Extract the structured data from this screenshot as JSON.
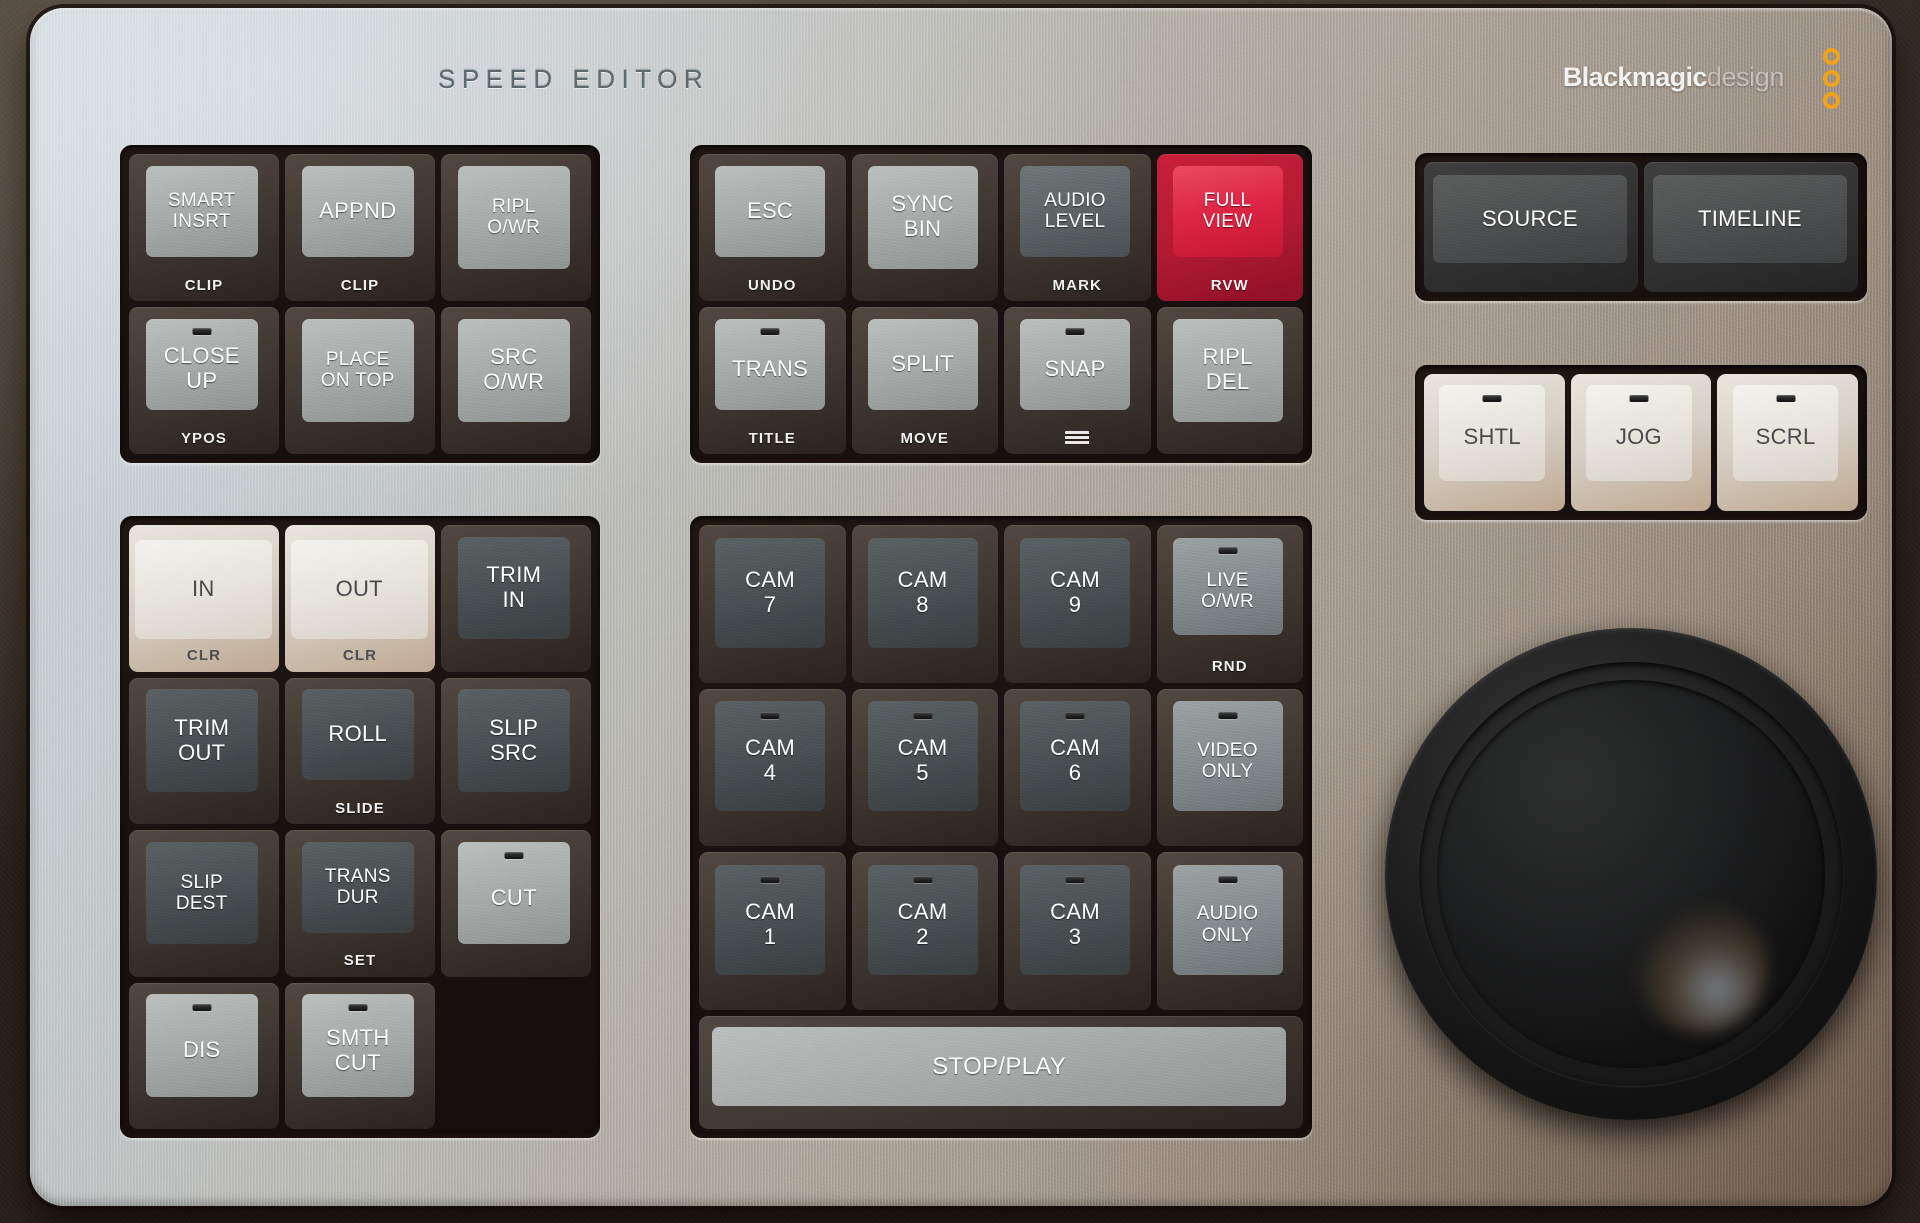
{
  "device": {
    "title": "SPEED EDITOR",
    "brand_primary": "Blackmagic",
    "brand_secondary": "design",
    "body_color": "#b4b2ab",
    "accent_red": "#dd2442",
    "brand_dot_color": "#f0a21c"
  },
  "groups": {
    "edit_group": {
      "name": "edit-functions",
      "keys": [
        {
          "label": "SMART\nINSRT",
          "sub": "CLIP",
          "cap": "gray-l",
          "housing": "lighthousing",
          "led": false
        },
        {
          "label": "APPND",
          "sub": "CLIP",
          "cap": "gray-l",
          "housing": "lighthousing",
          "led": false
        },
        {
          "label": "RIPL\nO/WR",
          "sub": "",
          "cap": "gray-l",
          "housing": "lighthousing",
          "led": false
        },
        {
          "label": "CLOSE\nUP",
          "sub": "YPOS",
          "cap": "gray-l",
          "housing": "lighthousing",
          "led": true
        },
        {
          "label": "PLACE\nON TOP",
          "sub": "",
          "cap": "gray-l",
          "housing": "lighthousing",
          "led": false
        },
        {
          "label": "SRC\nO/WR",
          "sub": "",
          "cap": "gray-l",
          "housing": "lighthousing",
          "led": false
        }
      ]
    },
    "transport_group": {
      "name": "timeline-tools",
      "keys": [
        {
          "label": "ESC",
          "sub": "UNDO",
          "cap": "gray-l",
          "housing": "lighthousing",
          "led": false
        },
        {
          "label": "SYNC\nBIN",
          "sub": "",
          "cap": "gray-l",
          "housing": "lighthousing",
          "led": false
        },
        {
          "label": "AUDIO\nLEVEL",
          "sub": "MARK",
          "cap": "gray-d",
          "housing": "lighthousing",
          "led": false
        },
        {
          "label": "FULL\nVIEW",
          "sub": "RVW",
          "cap": "red",
          "housing": "redhousing",
          "led": false
        },
        {
          "label": "TRANS",
          "sub": "TITLE",
          "cap": "gray-l",
          "housing": "lighthousing",
          "led": true
        },
        {
          "label": "SPLIT",
          "sub": "MOVE",
          "cap": "gray-l",
          "housing": "lighthousing",
          "led": false
        },
        {
          "label": "SNAP",
          "sub": "",
          "cap": "gray-l",
          "housing": "lighthousing",
          "led": true,
          "icon": "hamburger-icon"
        },
        {
          "label": "RIPL\nDEL",
          "sub": "",
          "cap": "gray-l",
          "housing": "lighthousing",
          "led": false
        }
      ]
    },
    "view_group": {
      "name": "source-timeline",
      "keys": [
        {
          "label": "SOURCE",
          "sub": "",
          "cap": "darkbtn",
          "housing": "darkhousing",
          "led": false
        },
        {
          "label": "TIMELINE",
          "sub": "",
          "cap": "darkbtn",
          "housing": "darkhousing",
          "led": false
        }
      ]
    },
    "wheel_mode_group": {
      "name": "wheel-modes",
      "keys": [
        {
          "label": "SHTL",
          "sub": "",
          "cap": "white",
          "housing": "whitehousing",
          "led": true
        },
        {
          "label": "JOG",
          "sub": "",
          "cap": "white",
          "housing": "whitehousing",
          "led": true
        },
        {
          "label": "SCRL",
          "sub": "",
          "cap": "white",
          "housing": "whitehousing",
          "led": true
        }
      ]
    },
    "trim_group": {
      "name": "trim-tools",
      "keys": [
        {
          "label": "IN",
          "sub": "CLR",
          "cap": "white",
          "housing": "whitehousing",
          "led": false,
          "sub_dark": true
        },
        {
          "label": "OUT",
          "sub": "CLR",
          "cap": "white",
          "housing": "whitehousing",
          "led": false,
          "sub_dark": true
        },
        {
          "label": "TRIM\nIN",
          "sub": "",
          "cap": "gray-dd",
          "housing": "lighthousing",
          "led": false
        },
        {
          "label": "TRIM\nOUT",
          "sub": "",
          "cap": "gray-dd",
          "housing": "lighthousing",
          "led": false
        },
        {
          "label": "ROLL",
          "sub": "SLIDE",
          "cap": "gray-dd",
          "housing": "lighthousing",
          "led": false
        },
        {
          "label": "SLIP\nSRC",
          "sub": "",
          "cap": "gray-dd",
          "housing": "lighthousing",
          "led": false
        },
        {
          "label": "SLIP\nDEST",
          "sub": "",
          "cap": "gray-dd",
          "housing": "lighthousing",
          "led": false
        },
        {
          "label": "TRANS\nDUR",
          "sub": "SET",
          "cap": "gray-dd",
          "housing": "lighthousing",
          "led": false
        },
        {
          "label": "CUT",
          "sub": "",
          "cap": "gray-l",
          "housing": "lighthousing",
          "led": true
        },
        {
          "label": "DIS",
          "sub": "",
          "cap": "gray-l",
          "housing": "lighthousing",
          "led": true
        },
        {
          "label": "SMTH\nCUT",
          "sub": "",
          "cap": "gray-l",
          "housing": "lighthousing",
          "led": true
        }
      ]
    },
    "camera_group": {
      "name": "camera-selection",
      "keys": [
        {
          "label": "CAM\n7",
          "sub": "",
          "cap": "gray-dd",
          "housing": "lighthousing",
          "led": false
        },
        {
          "label": "CAM\n8",
          "sub": "",
          "cap": "gray-dd",
          "housing": "lighthousing",
          "led": false
        },
        {
          "label": "CAM\n9",
          "sub": "",
          "cap": "gray-dd",
          "housing": "lighthousing",
          "led": false
        },
        {
          "label": "LIVE\nO/WR",
          "sub": "RND",
          "cap": "gray-m",
          "housing": "lighthousing",
          "led": true
        },
        {
          "label": "CAM\n4",
          "sub": "",
          "cap": "gray-dd",
          "housing": "lighthousing",
          "led": true
        },
        {
          "label": "CAM\n5",
          "sub": "",
          "cap": "gray-dd",
          "housing": "lighthousing",
          "led": true
        },
        {
          "label": "CAM\n6",
          "sub": "",
          "cap": "gray-dd",
          "housing": "lighthousing",
          "led": true
        },
        {
          "label": "VIDEO\nONLY",
          "sub": "",
          "cap": "gray-m",
          "housing": "lighthousing",
          "led": true
        },
        {
          "label": "CAM\n1",
          "sub": "",
          "cap": "gray-dd",
          "housing": "lighthousing",
          "led": true
        },
        {
          "label": "CAM\n2",
          "sub": "",
          "cap": "gray-dd",
          "housing": "lighthousing",
          "led": true
        },
        {
          "label": "CAM\n3",
          "sub": "",
          "cap": "gray-dd",
          "housing": "lighthousing",
          "led": true
        },
        {
          "label": "AUDIO\nONLY",
          "sub": "",
          "cap": "gray-m",
          "housing": "lighthousing",
          "led": true
        }
      ],
      "stop_play": {
        "label": "STOP/PLAY",
        "cap": "gray-l"
      }
    }
  },
  "jog_wheel": {
    "name": "search-dial"
  }
}
